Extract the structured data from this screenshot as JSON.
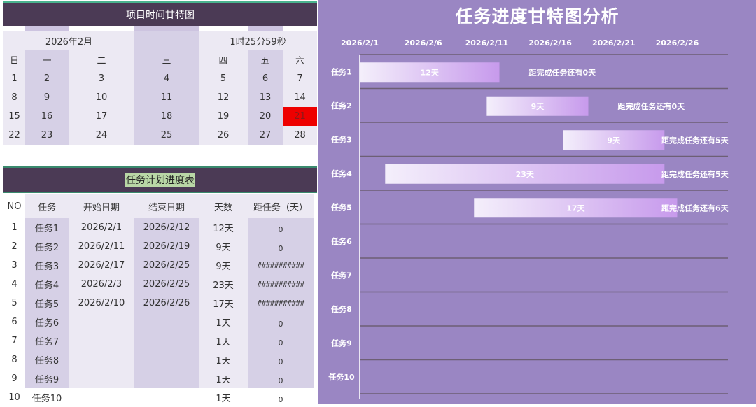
{
  "calendar": {
    "title": "项目时间甘特图",
    "month": "2026年2月",
    "clock": "1时25分59秒",
    "weekdays": [
      "日",
      "一",
      "二",
      "三",
      "四",
      "五",
      "六"
    ],
    "weeks": [
      [
        "1",
        "2",
        "3",
        "4",
        "5",
        "6",
        "7"
      ],
      [
        "8",
        "9",
        "10",
        "11",
        "12",
        "13",
        "14"
      ],
      [
        "15",
        "16",
        "17",
        "18",
        "19",
        "20",
        "21"
      ],
      [
        "22",
        "23",
        "24",
        "25",
        "26",
        "27",
        "28"
      ]
    ],
    "highlight_color": "#ee0000"
  },
  "plan": {
    "title": "任务计划进度表",
    "headers": [
      "NO",
      "任务",
      "开始日期",
      "结束日期",
      "天数",
      "距任务（天）"
    ],
    "rows": [
      [
        "1",
        "任务1",
        "2026/2/1",
        "2026/2/12",
        "12天",
        "0"
      ],
      [
        "2",
        "任务2",
        "2026/2/11",
        "2026/2/19",
        "9天",
        "0"
      ],
      [
        "3",
        "任务3",
        "2026/2/17",
        "2026/2/25",
        "9天",
        "###########"
      ],
      [
        "4",
        "任务4",
        "2026/2/3",
        "2026/2/25",
        "23天",
        "###########"
      ],
      [
        "5",
        "任务5",
        "2026/2/10",
        "2026/2/26",
        "17天",
        "###########"
      ],
      [
        "6",
        "任务6",
        "",
        "",
        "1天",
        "0"
      ],
      [
        "7",
        "任务7",
        "",
        "",
        "1天",
        "0"
      ],
      [
        "8",
        "任务8",
        "",
        "",
        "1天",
        "0"
      ],
      [
        "9",
        "任务9",
        "",
        "",
        "1天",
        "0"
      ],
      [
        "10",
        "任务10",
        "",
        "",
        "1天",
        "0"
      ]
    ]
  },
  "chart_data": {
    "type": "bar",
    "orientation": "horizontal",
    "title": "任务进度甘特图分析",
    "x_ticks": [
      "2026/2/1",
      "2026/2/6",
      "2026/2/11",
      "2026/2/16",
      "2026/2/21",
      "2026/2/26"
    ],
    "xlim": [
      "2026/2/1",
      "2026/3/2"
    ],
    "categories": [
      "任务1",
      "任务2",
      "任务3",
      "任务4",
      "任务5",
      "任务6",
      "任务7",
      "任务8",
      "任务9",
      "任务10"
    ],
    "bars": [
      {
        "task": "任务1",
        "start": "2026/2/1",
        "days": 12,
        "label": "12天",
        "remain_label": "距完成任务还有0天"
      },
      {
        "task": "任务2",
        "start": "2026/2/11",
        "days": 9,
        "label": "9天",
        "remain_label": "距完成任务还有0天"
      },
      {
        "task": "任务3",
        "start": "2026/2/17",
        "days": 9,
        "label": "9天",
        "remain_label": "距完成任务还有5天"
      },
      {
        "task": "任务4",
        "start": "2026/2/3",
        "days": 23,
        "label": "23天",
        "remain_label": "距完成任务还有5天"
      },
      {
        "task": "任务5",
        "start": "2026/2/10",
        "days": 17,
        "label": "17天",
        "remain_label": "距完成任务还有6天"
      }
    ],
    "grid": true,
    "background_color": "#9a86c3",
    "bar_color_start": "#f4effb",
    "bar_color_end": "#c79aec"
  }
}
